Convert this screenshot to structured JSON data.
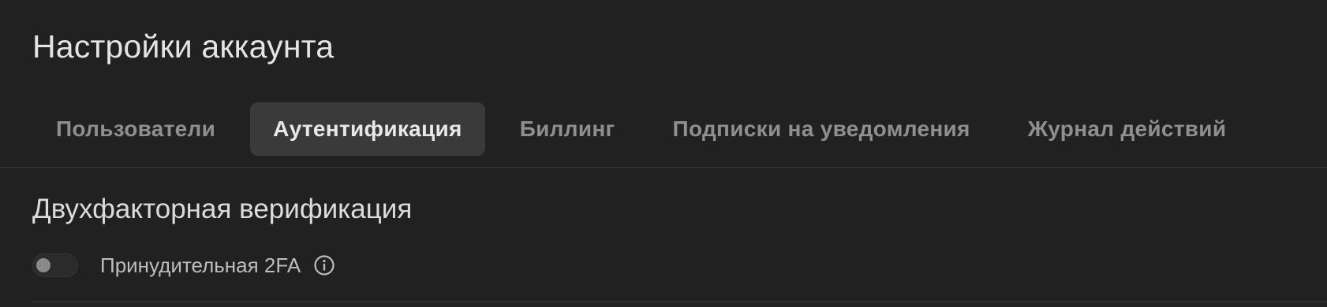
{
  "header": {
    "title": "Настройки аккаунта"
  },
  "tabs": [
    {
      "label": "Пользователи",
      "active": false
    },
    {
      "label": "Аутентификация",
      "active": true
    },
    {
      "label": "Биллинг",
      "active": false
    },
    {
      "label": "Подписки на уведомления",
      "active": false
    },
    {
      "label": "Журнал действий",
      "active": false
    }
  ],
  "section": {
    "title": "Двухфакторная верификация",
    "setting": {
      "label": "Принудительная 2FA",
      "enabled": false,
      "icon": "info-icon"
    }
  },
  "colors": {
    "background": "#212121",
    "active_tab_bg": "#3a3a3a",
    "inactive_tab_text": "#8f8f8f",
    "active_tab_text": "#e8e8e8"
  }
}
